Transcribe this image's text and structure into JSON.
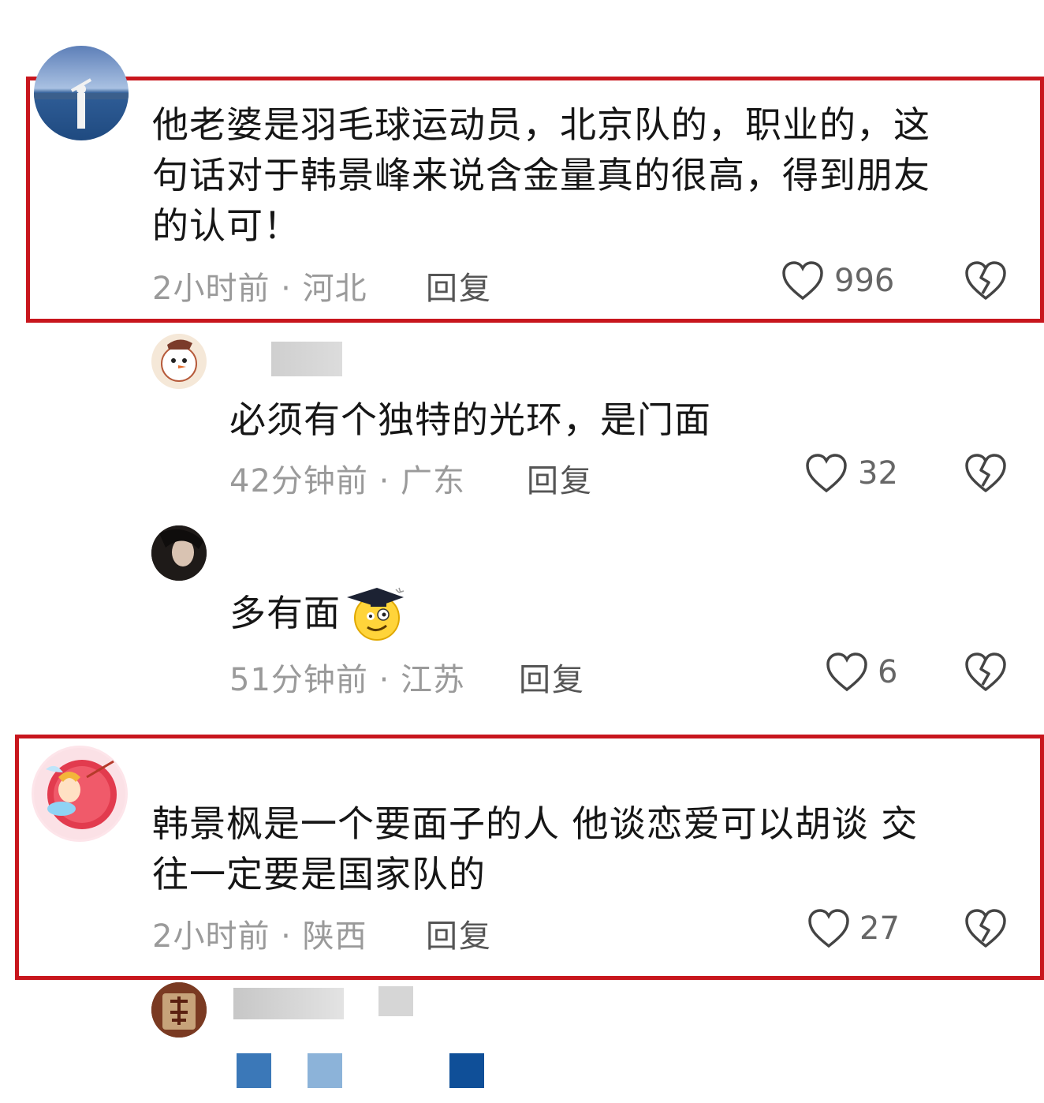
{
  "colors": {
    "highlight": "#c8161d",
    "meta": "#9a9a9a",
    "text": "#161616"
  },
  "comments": [
    {
      "text": "他老婆是羽毛球运动员，北京队的，职业的，这句话对于韩景峰来说含金量真的很高，得到朋友的认可！",
      "lines": [
        "他老婆是羽毛球运动员，北京队的，职业的，这",
        "句话对于韩景峰来说含金量真的很高，得到朋友",
        "的认可！"
      ],
      "meta": "2小时前 · 河北",
      "reply": "回复",
      "likes": "996"
    },
    {
      "text": "必须有个独特的光环，是门面",
      "meta": "42分钟前 · 广东",
      "reply": "回复",
      "likes": "32"
    },
    {
      "text": "多有面",
      "emoji": "graduation-cap-face-emoji",
      "meta": "51分钟前 · 江苏",
      "reply": "回复",
      "likes": "6"
    },
    {
      "text": "韩景枫是一个要面子的人 他谈恋爱可以胡谈 交往一定要是国家队的",
      "lines": [
        "韩景枫是一个要面子的人 他谈恋爱可以胡谈 交",
        "往一定要是国家队的"
      ],
      "meta": "2小时前 · 陕西",
      "reply": "回复",
      "likes": "27"
    }
  ],
  "icons": {
    "like": "heart-outline-icon",
    "dislike": "broken-heart-icon"
  }
}
